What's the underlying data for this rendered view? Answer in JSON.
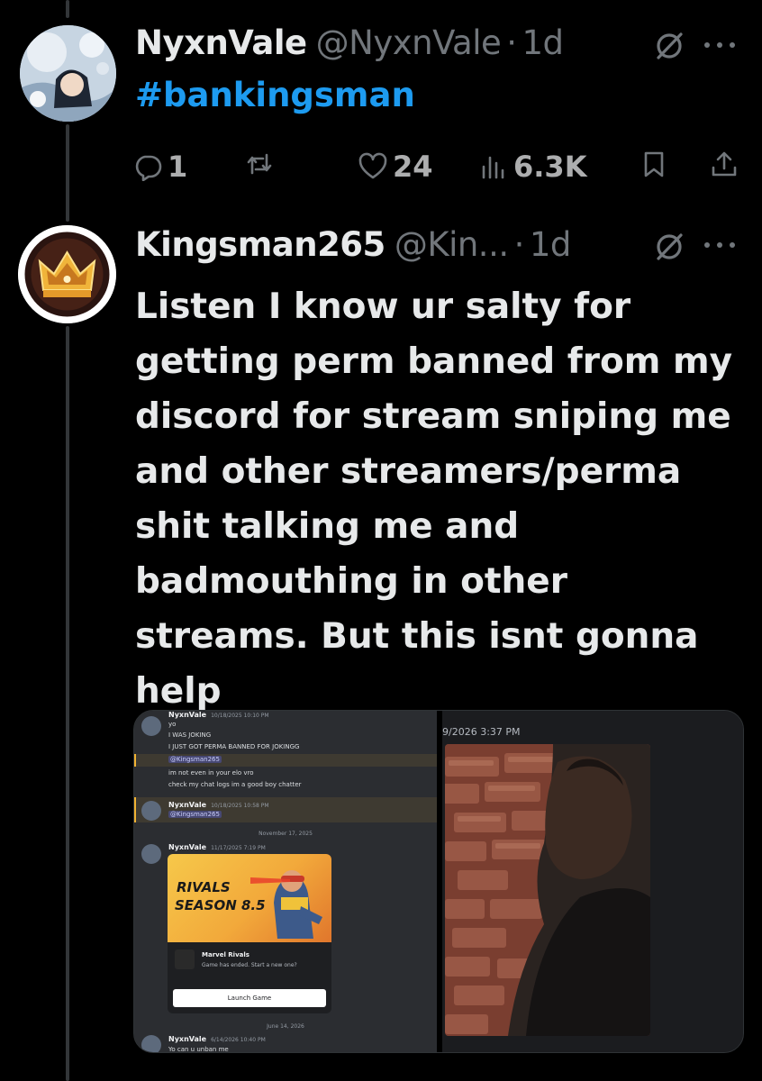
{
  "tweet1": {
    "name": "NyxnVale",
    "handle": "@NyxnVale",
    "separator": "·",
    "time": "1d",
    "text": "#bankingsman",
    "actions": {
      "replies": "1",
      "reposts": "",
      "likes": "24",
      "views": "6.3K"
    }
  },
  "tweet2": {
    "name": "Kingsman265",
    "handle": "@Kin...",
    "separator": "·",
    "time": "1d",
    "text": "Listen I know ur salty for getting perm banned from my discord for stream sniping me and other streamers/perma shit talking me and badmouthing in other streams. But this isnt gonna help"
  },
  "media": {
    "discord": {
      "msg1": {
        "author": "NyxnVale",
        "timestamp": "10/18/2025 10:10 PM",
        "lines": [
          "yo",
          "I WAS JOKING",
          "I JUST GOT PERMA BANNED FOR JOKINGG"
        ],
        "mention": "@Kingsman265",
        "lines2": [
          "im not even in your elo vro",
          "check my chat logs im a good boy chatter"
        ]
      },
      "msg2": {
        "author": "NyxnVale",
        "timestamp": "10/18/2025 10:58 PM",
        "mention": "@Kingsman265"
      },
      "date1": "November 17, 2025",
      "msg3": {
        "author": "NyxnVale",
        "timestamp": "11/17/2025 7:19 PM"
      },
      "game": {
        "logo": "RIVALS",
        "season": "SEASON 8.5",
        "title": "Marvel Rivals",
        "status": "Game has ended. Start a new one?",
        "button": "Launch Game"
      },
      "date2": "June 14, 2026",
      "msg4": {
        "author": "NyxnVale",
        "timestamp": "6/14/2026 10:40 PM",
        "line": "Yo can u unban me"
      }
    },
    "right_timestamp": "9/2026 3:37 PM"
  },
  "colors": {
    "background": "#000000",
    "text": "#e7e9ea",
    "muted": "#71767b",
    "link": "#1d9bf0"
  }
}
